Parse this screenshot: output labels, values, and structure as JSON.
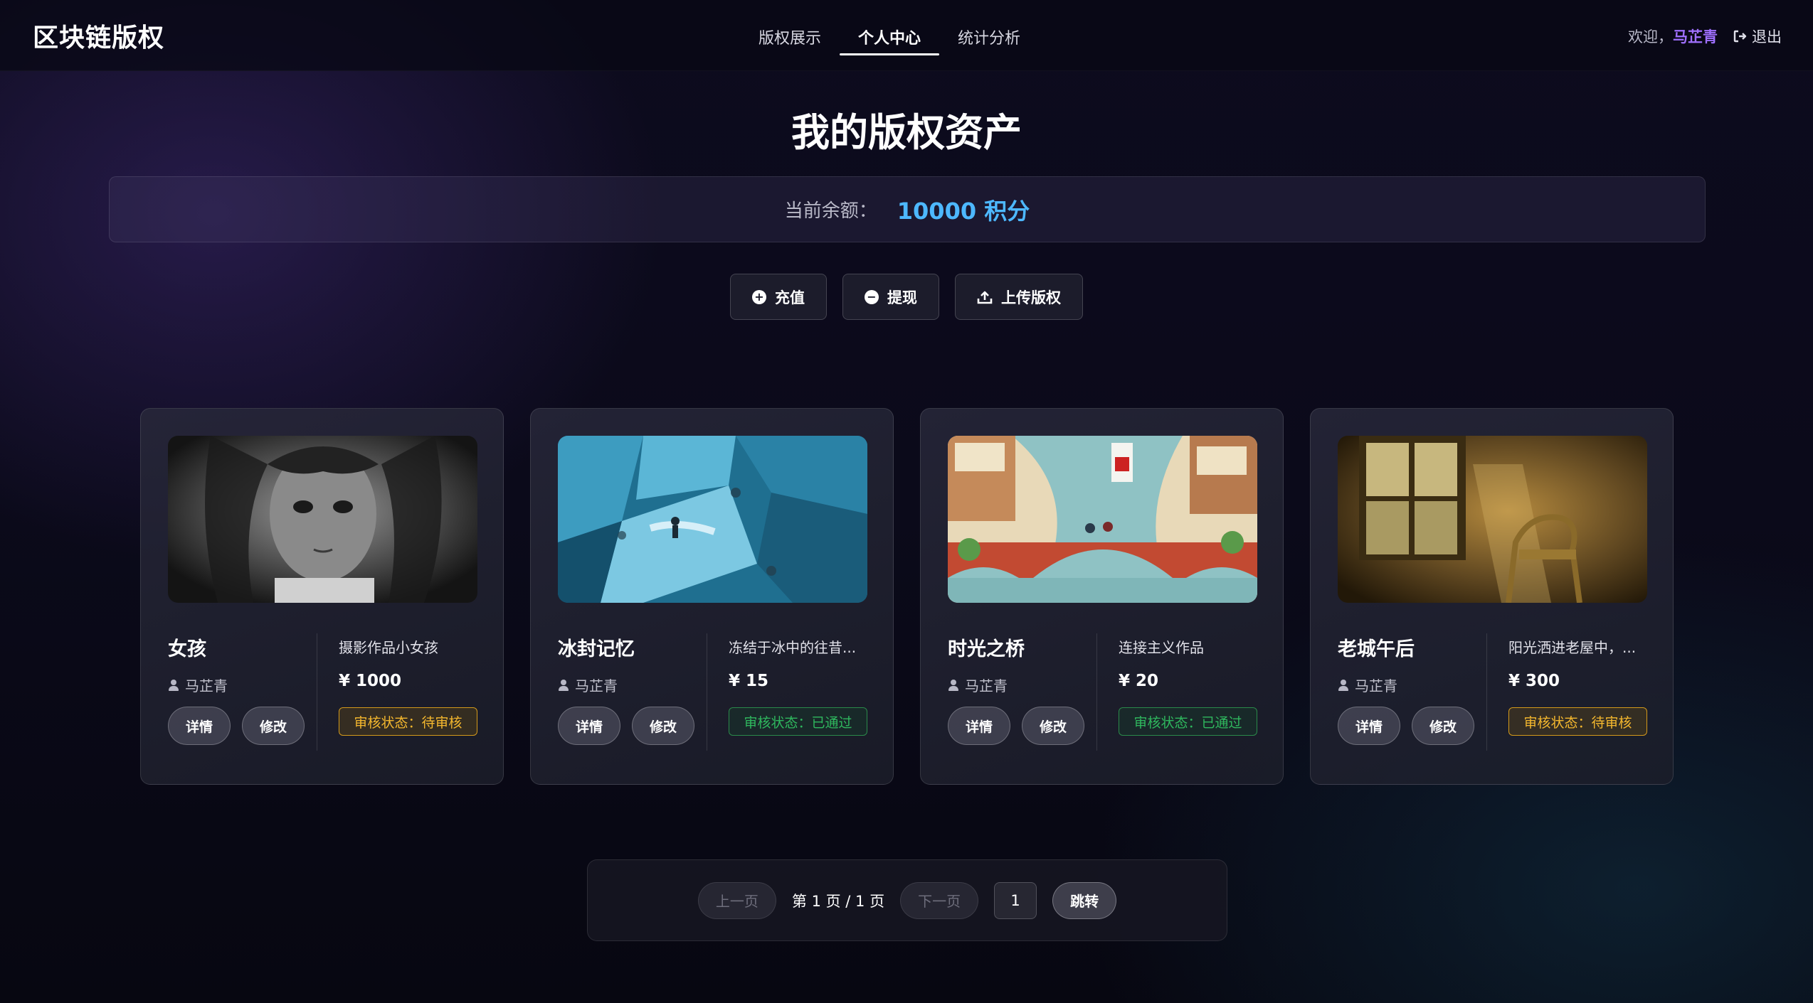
{
  "nav": {
    "brand": "区块链版权",
    "tabs": [
      {
        "label": "版权展示",
        "active": false
      },
      {
        "label": "个人中心",
        "active": true
      },
      {
        "label": "统计分析",
        "active": false
      }
    ],
    "welcome": "欢迎，",
    "username": "马芷青",
    "logout": "退出"
  },
  "page": {
    "title": "我的版权资产",
    "balance_label": "当前余额：",
    "balance_value": "10000 积分"
  },
  "actions": [
    {
      "label": "充值",
      "icon": "plus-circle-icon"
    },
    {
      "label": "提现",
      "icon": "minus-circle-icon"
    },
    {
      "label": "上传版权",
      "icon": "upload-icon"
    }
  ],
  "cards": [
    {
      "title": "女孩",
      "author": "马芷青",
      "desc": "摄影作品小女孩",
      "price": "¥ 1000",
      "status": "审核状态：待审核",
      "status_type": "pending",
      "detail": "详情",
      "edit": "修改",
      "image": "bw-portrait-girl"
    },
    {
      "title": "冰封记忆",
      "author": "马芷青",
      "desc": "冻结于冰中的往昔...",
      "price": "¥ 15",
      "status": "审核状态：已通过",
      "status_type": "ok",
      "detail": "详情",
      "edit": "修改",
      "image": "frozen-ice-blocks"
    },
    {
      "title": "时光之桥",
      "author": "马芷青",
      "desc": "连接主义作品",
      "price": "¥ 20",
      "status": "审核状态：已通过",
      "status_type": "ok",
      "detail": "详情",
      "edit": "修改",
      "image": "illustrated-bridge-canal"
    },
    {
      "title": "老城午后",
      "author": "马芷青",
      "desc": "阳光洒进老屋中，...",
      "price": "¥ 300",
      "status": "审核状态：待审核",
      "status_type": "pending",
      "detail": "详情",
      "edit": "修改",
      "image": "sunlit-room-chair"
    }
  ],
  "pager": {
    "prev": "上一页",
    "info": "第 1 页 / 1 页",
    "next": "下一页",
    "input_value": "1",
    "go": "跳转"
  },
  "colors": {
    "accent_username": "#a070ff",
    "balance_value": "#4db8ff",
    "status_pending": "#f5b82e",
    "status_ok": "#2fb85e"
  }
}
